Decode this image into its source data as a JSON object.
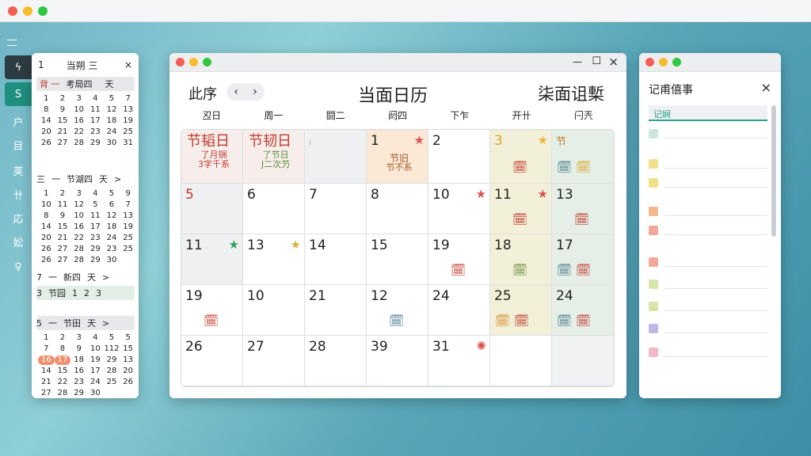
{
  "menubar": {
    "menu_icon": "hamburger-icon"
  },
  "sidebar": {
    "items": [
      {
        "label": "ϟ"
      },
      {
        "label": "S"
      },
      {
        "label": "户"
      },
      {
        "label": "目"
      },
      {
        "label": "荚"
      },
      {
        "label": "卄"
      },
      {
        "label": "応"
      },
      {
        "label": "妐"
      },
      {
        "label": "♀"
      }
    ]
  },
  "mini": {
    "title": "当朔 三",
    "title_num": "1",
    "close": "×",
    "m1": {
      "days": [
        "1",
        "2",
        "3",
        "4",
        "5",
        "7",
        "8",
        "9",
        "10",
        "11",
        "12",
        "13",
        "14",
        "15",
        "16",
        "17",
        "18",
        "19",
        "20",
        "21",
        "22",
        "23",
        "24",
        "25",
        "26",
        "27",
        "28",
        "29",
        "30",
        "31"
      ],
      "h": [
        "背 一",
        "考局四",
        "天"
      ]
    },
    "m2": {
      "head": [
        "三",
        "一",
        "节湖四",
        "天",
        ">"
      ],
      "days": [
        "1",
        "2",
        "3",
        "4",
        "5",
        "9",
        "10",
        "11",
        "12",
        "5",
        "6",
        "7",
        "8",
        "9",
        "10",
        "11",
        "12",
        "13",
        "14",
        "15",
        "16",
        "17",
        "18",
        "19",
        "20",
        "21",
        "22",
        "23",
        "24",
        "25",
        "26",
        "27",
        "28",
        "29",
        "23",
        "25",
        "26",
        "27",
        "28",
        "29",
        "30"
      ]
    },
    "m3": {
      "head": [
        "7",
        "一",
        "新四",
        "天",
        ">"
      ],
      "sub1": [
        "3",
        "节园",
        "1",
        "2",
        "3"
      ],
      "sub2": [
        "5",
        "一",
        "节田",
        "天",
        ">"
      ],
      "days": [
        "1",
        "2",
        "3",
        "4",
        "5",
        "5",
        "7",
        "8",
        "9",
        "10",
        "112",
        "15",
        "16",
        "17",
        "18",
        "19",
        "29",
        "13",
        "14",
        "15",
        "16",
        "17",
        "28",
        "20",
        "21",
        "22",
        "23",
        "24",
        "25",
        "26",
        "27",
        "28",
        "29",
        "30"
      ]
    }
  },
  "main": {
    "toolbar": {
      "left_label": "此序",
      "nav_prev": "‹",
      "nav_next": "›",
      "title": "当面日历",
      "right_label": "柒面诅槧"
    },
    "controls": {
      "min": "—",
      "max": "☐",
      "close": "×"
    },
    "weekdays": [
      "丒日",
      "周一",
      "闘二",
      "阏四",
      "下乍",
      "开卄",
      "闩兲"
    ],
    "row1": [
      {
        "num": "",
        "fest": "节韬日",
        "sub": "了月锎",
        "sub2": "3字千系"
      },
      {
        "num": "",
        "fest": "节韧日",
        "sub": "了节日",
        "sub2": "J二次芀"
      },
      {
        "num": "⁞",
        "fest": "",
        "sub": ""
      },
      {
        "num": "1",
        "fest": "",
        "sub": "节旧",
        "sub2": "节不系"
      },
      {
        "num": "2",
        "fest": "",
        "sub": ""
      },
      {
        "num": "3",
        "fest": "",
        "sub": ""
      },
      {
        "num": "节",
        "fest": "",
        "sub": ""
      }
    ],
    "rows": [
      [
        "5",
        "6",
        "7",
        "8",
        "10",
        "11",
        "13"
      ],
      [
        "11",
        "13",
        "14",
        "15",
        "19",
        "18",
        "17"
      ],
      [
        "19",
        "10",
        "21",
        "12",
        "24",
        "25",
        "24"
      ],
      [
        "26",
        "27",
        "28",
        "39",
        "31",
        "",
        ""
      ]
    ]
  },
  "notes": {
    "title": "记甫僖事",
    "close": "×",
    "tab": "记娴"
  },
  "colors": {
    "accent": "#d9534f",
    "green": "#2e9e60",
    "gold": "#e0b83a",
    "teal": "#2aa38a"
  }
}
